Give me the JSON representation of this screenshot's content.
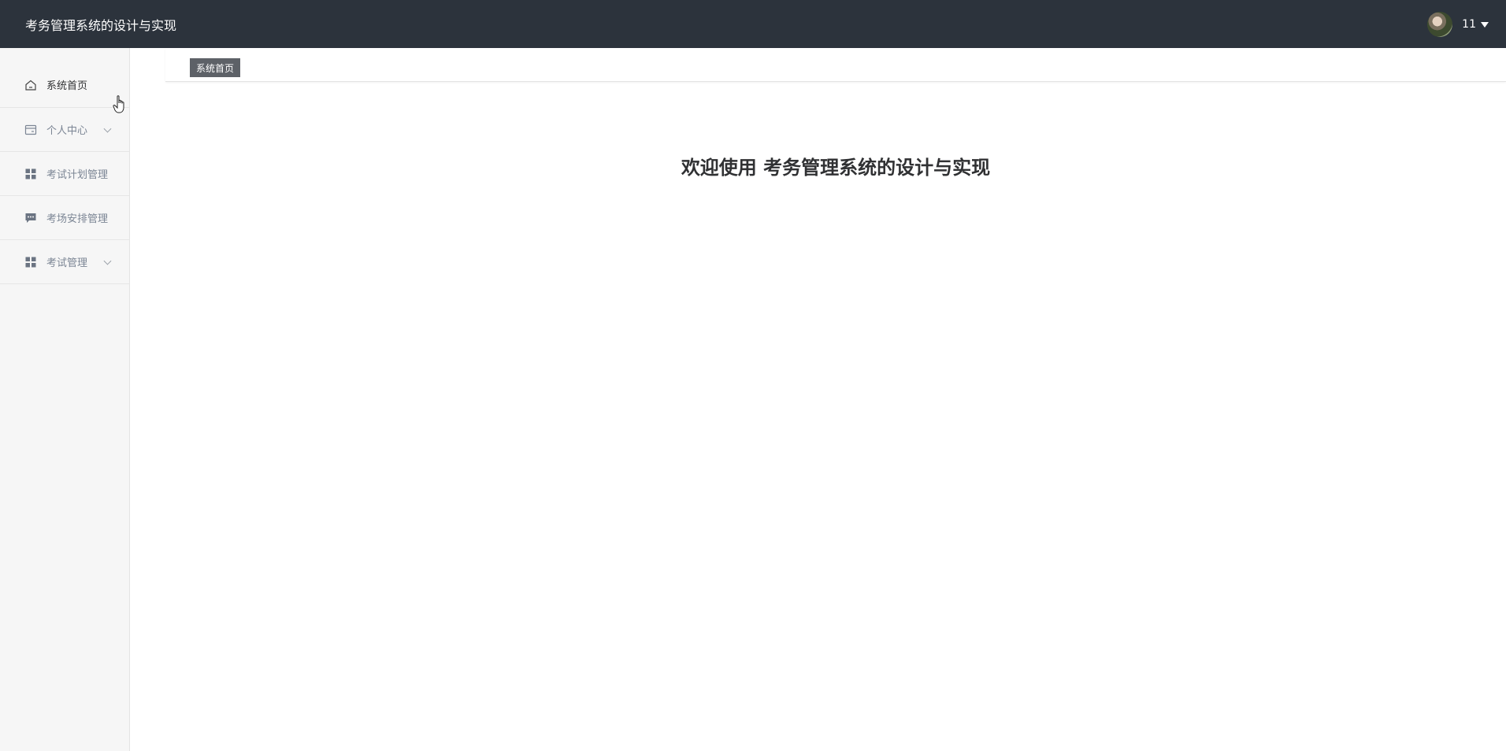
{
  "header": {
    "title": "考务管理系统的设计与实现",
    "username": "11"
  },
  "sidebar": {
    "items": [
      {
        "label": "系统首页",
        "icon": "home-icon",
        "active": true
      },
      {
        "label": "个人中心",
        "icon": "card-icon",
        "expandable": true
      },
      {
        "label": "考试计划管理",
        "icon": "grid-icon"
      },
      {
        "label": "考场安排管理",
        "icon": "message-icon"
      },
      {
        "label": "考试管理",
        "icon": "grid-icon",
        "expandable": true
      }
    ]
  },
  "tabs": [
    {
      "label": "系统首页",
      "active": true
    }
  ],
  "main": {
    "welcome": "欢迎使用 考务管理系统的设计与实现"
  },
  "colors": {
    "header_bg": "#2c333c",
    "sidebar_bg": "#f6f6f6",
    "tab_bg": "#5d6167"
  }
}
